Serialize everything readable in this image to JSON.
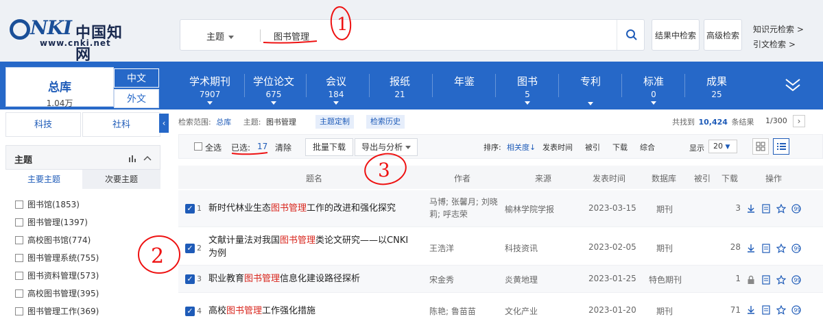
{
  "header": {
    "logo": {
      "nki": "NKI",
      "cn": "中国知网",
      "url": "www.cnki.net"
    },
    "search": {
      "scope": "主题",
      "query": "图书管理"
    },
    "btn_within": "结果中检索",
    "btn_advanced": "高级检索",
    "link_knowledge": "知识元检索 >",
    "link_citation": "引文检索 >"
  },
  "nav": {
    "zongku": {
      "label": "总库",
      "count": "1.04万"
    },
    "lang_zh": "中文",
    "lang_wai": "外文",
    "items": [
      {
        "label": "学术期刊",
        "count": "7907"
      },
      {
        "label": "学位论文",
        "count": "675"
      },
      {
        "label": "会议",
        "count": "184"
      },
      {
        "label": "报纸",
        "count": "21"
      },
      {
        "label": "年鉴",
        "count": ""
      },
      {
        "label": "图书",
        "count": "5"
      },
      {
        "label": "专利",
        "count": ""
      },
      {
        "label": "标准",
        "count": "0"
      },
      {
        "label": "成果",
        "count": "25"
      }
    ]
  },
  "left": {
    "tab_sci": "科技",
    "tab_soc": "社科",
    "topic_title": "主题",
    "topic_tab_main": "主要主题",
    "topic_tab_sub": "次要主题",
    "facets": [
      "图书馆(1853)",
      "图书管理(1397)",
      "高校图书馆(774)",
      "图书管理系统(755)",
      "图书资料管理(573)",
      "高校图书管理(395)",
      "图书管理工作(369)"
    ]
  },
  "main": {
    "scope_label": "检索范围:",
    "scope_value": "总库",
    "topic_label": "主题:",
    "topic_value": "图书管理",
    "btn_custom": "主题定制",
    "btn_history": "检索历史",
    "found_prefix": "共找到",
    "found_count": "10,424",
    "found_suffix": "条结果",
    "page_info": "1/300",
    "toolbar": {
      "select_all": "全选",
      "selected_label": "已选:",
      "selected_count": "17",
      "clear": "清除",
      "batch_download": "批量下载",
      "export": "导出与分析",
      "sort_label": "排序:",
      "sort_relevance": "相关度",
      "sort_date": "发表时间",
      "sort_cited": "被引",
      "sort_download": "下载",
      "sort_composite": "综合",
      "display_label": "显示",
      "display_value": "20"
    },
    "columns": [
      "题名",
      "作者",
      "来源",
      "发表时间",
      "数据库",
      "被引",
      "下载",
      "操作"
    ],
    "rows": [
      {
        "idx": "1",
        "pre": "新时代林业生态",
        "hl": "图书管理",
        "post": "工作的改进和强化探究",
        "author": "马博; 张馨月; 刘晓莉; 呼志荣",
        "source": "榆林学院学报",
        "date": "2023-03-15",
        "db": "期刊",
        "cited": "",
        "dl": "3"
      },
      {
        "idx": "2",
        "pre": "文献计量法对我国",
        "hl": "图书管理",
        "post": "类论文研究——以CNKI为例",
        "author": "王浩洋",
        "source": "科技资讯",
        "date": "2023-02-05",
        "db": "期刊",
        "cited": "",
        "dl": "28"
      },
      {
        "idx": "3",
        "pre": "职业教育",
        "hl": "图书管理",
        "post": "信息化建设路径探析",
        "author": "宋金秀",
        "source": "炎黄地理",
        "date": "2023-01-25",
        "db": "特色期刊",
        "cited": "",
        "dl": "1"
      },
      {
        "idx": "4",
        "pre": "高校",
        "hl": "图书管理",
        "post": "工作强化措施",
        "author": "陈艳; 鲁苗苗",
        "source": "文化产业",
        "date": "2023-01-20",
        "db": "期刊",
        "cited": "",
        "dl": "71"
      }
    ]
  },
  "annotations": [
    "1",
    "2",
    "3"
  ],
  "colors": {
    "brand": "#2668c8",
    "highlight": "#d8261d",
    "annotation": "#e11"
  }
}
